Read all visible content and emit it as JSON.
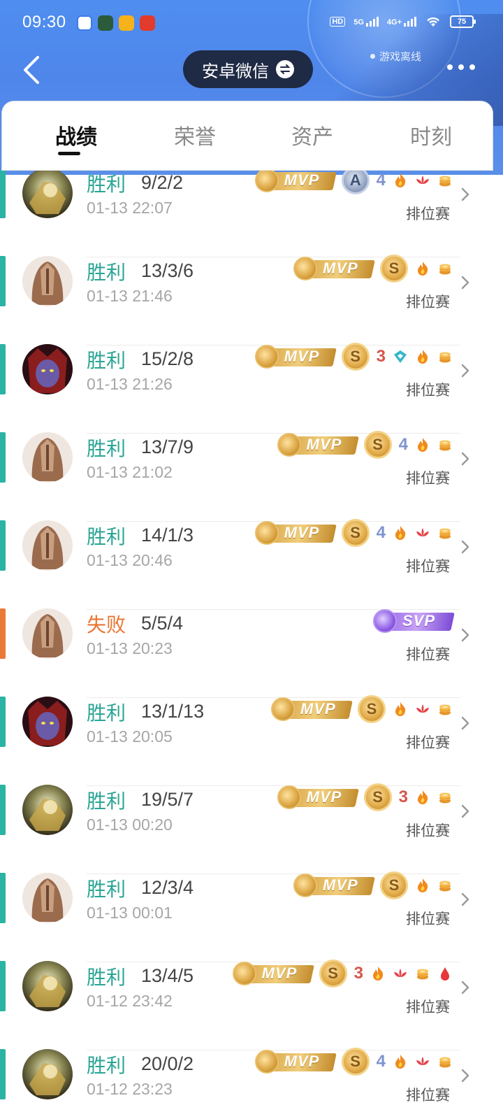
{
  "status_bar": {
    "time": "09:30",
    "battery": "75",
    "network_1": "5G",
    "network_2": "4G+",
    "hd": "HD"
  },
  "header": {
    "account_switch_label": "安卓微信",
    "offline_status": "游戏离线"
  },
  "tabs": [
    {
      "label": "战绩",
      "active": true
    },
    {
      "label": "荣誉",
      "active": false
    },
    {
      "label": "资产",
      "active": false
    },
    {
      "label": "时刻",
      "active": false
    }
  ],
  "colors": {
    "win": "#2aa594",
    "lose": "#e97431",
    "header_blue": "#4f8ef0"
  },
  "matches": [
    {
      "result": "胜利",
      "outcome": "win",
      "kda": "9/2/2",
      "time": "01-13 22:07",
      "mode": "排位赛",
      "hero": "gold-armored-hero",
      "badges": [
        "mvp",
        "a-rating",
        "quadra-kill",
        "fire",
        "lotus",
        "coin"
      ]
    },
    {
      "result": "胜利",
      "outcome": "win",
      "kda": "13/3/6",
      "time": "01-13 21:46",
      "mode": "排位赛",
      "hero": "bronze-masked-hero",
      "badges": [
        "mvp",
        "s-rating",
        "fire",
        "coin"
      ]
    },
    {
      "result": "胜利",
      "outcome": "win",
      "kda": "15/2/8",
      "time": "01-13 21:26",
      "mode": "排位赛",
      "hero": "purple-demon-hero",
      "badges": [
        "mvp",
        "s-rating",
        "triple-kill",
        "shield",
        "fire",
        "coin"
      ]
    },
    {
      "result": "胜利",
      "outcome": "win",
      "kda": "13/7/9",
      "time": "01-13 21:02",
      "mode": "排位赛",
      "hero": "bronze-masked-hero",
      "badges": [
        "mvp",
        "s-rating",
        "quadra-kill",
        "fire",
        "coin"
      ]
    },
    {
      "result": "胜利",
      "outcome": "win",
      "kda": "14/1/3",
      "time": "01-13 20:46",
      "mode": "排位赛",
      "hero": "bronze-masked-hero",
      "badges": [
        "mvp",
        "s-rating",
        "quadra-kill",
        "fire",
        "lotus",
        "coin"
      ]
    },
    {
      "result": "失败",
      "outcome": "lose",
      "kda": "5/5/4",
      "time": "01-13 20:23",
      "mode": "排位赛",
      "hero": "bronze-masked-hero",
      "badges": [
        "svp"
      ]
    },
    {
      "result": "胜利",
      "outcome": "win",
      "kda": "13/1/13",
      "time": "01-13 20:05",
      "mode": "排位赛",
      "hero": "purple-demon-hero",
      "badges": [
        "mvp",
        "s-rating",
        "fire",
        "lotus",
        "coin"
      ]
    },
    {
      "result": "胜利",
      "outcome": "win",
      "kda": "19/5/7",
      "time": "01-13 00:20",
      "mode": "排位赛",
      "hero": "gold-armored-hero",
      "badges": [
        "mvp",
        "s-rating",
        "triple-kill",
        "fire",
        "coin"
      ]
    },
    {
      "result": "胜利",
      "outcome": "win",
      "kda": "12/3/4",
      "time": "01-13 00:01",
      "mode": "排位赛",
      "hero": "bronze-masked-hero",
      "badges": [
        "mvp",
        "s-rating",
        "fire",
        "coin"
      ]
    },
    {
      "result": "胜利",
      "outcome": "win",
      "kda": "13/4/5",
      "time": "01-12 23:42",
      "mode": "排位赛",
      "hero": "gold-armored-hero",
      "badges": [
        "mvp",
        "s-rating",
        "triple-kill",
        "fire",
        "lotus",
        "coin",
        "blood"
      ]
    },
    {
      "result": "胜利",
      "outcome": "win",
      "kda": "20/0/2",
      "time": "01-12 23:23",
      "mode": "排位赛",
      "hero": "gold-armored-hero",
      "badges": [
        "mvp",
        "s-rating",
        "quadra-kill",
        "fire",
        "lotus",
        "coin"
      ]
    }
  ],
  "badge_text": {
    "mvp": "MVP",
    "svp": "SVP",
    "s": "S",
    "a": "A",
    "quadra": "4",
    "triple": "3"
  }
}
